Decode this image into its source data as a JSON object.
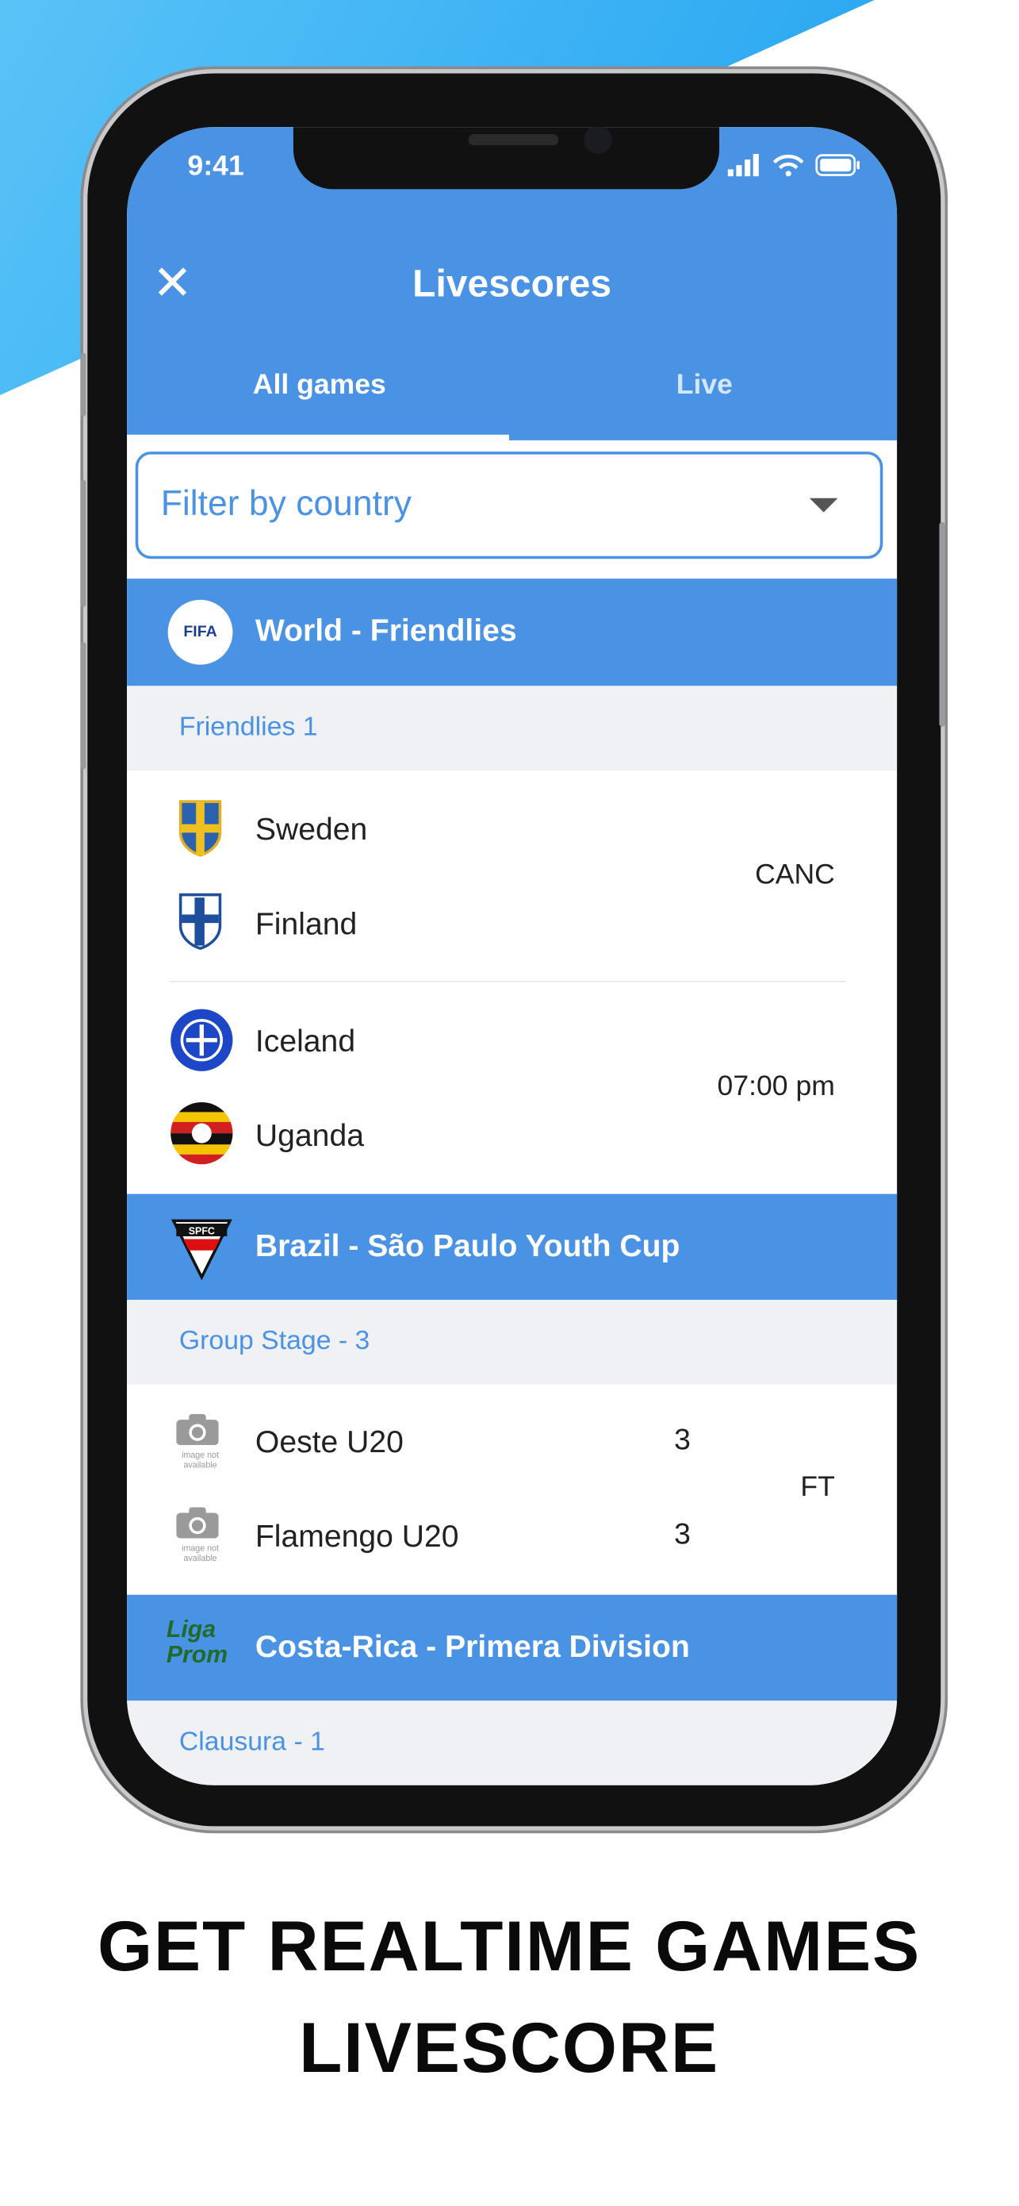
{
  "status_bar": {
    "time": "9:41"
  },
  "header": {
    "title": "Livescores",
    "close_icon": "close-icon"
  },
  "tabs": [
    {
      "label": "All games",
      "active": true
    },
    {
      "label": "Live",
      "active": false
    }
  ],
  "filter": {
    "placeholder": "Filter by country"
  },
  "colors": {
    "primary": "#4a92e4",
    "subheader_bg": "#eff1f5",
    "background_accent": "#29a8f3"
  },
  "leagues": [
    {
      "name": "World - Friendlies",
      "logo_text": "FIFA",
      "round": "Friendlies 1",
      "matches": [
        {
          "home": "Sweden",
          "away": "Finland",
          "status": "CANC"
        },
        {
          "home": "Iceland",
          "away": "Uganda",
          "status": "07:00 pm"
        }
      ]
    },
    {
      "name": "Brazil - São Paulo Youth Cup",
      "logo_text": "SPFC",
      "round": "Group Stage - 3",
      "matches": [
        {
          "home": "Oeste U20",
          "away": "Flamengo U20",
          "home_score": "3",
          "away_score": "3",
          "status": "FT",
          "logo_placeholder": "image not available"
        }
      ]
    },
    {
      "name": "Costa-Rica - Primera Division",
      "logo_text": "Liga Prom",
      "round": "Clausura - 1",
      "matches": []
    }
  ],
  "caption": {
    "line1": "GET REALTIME GAMES",
    "line2": "LIVESCORE"
  }
}
